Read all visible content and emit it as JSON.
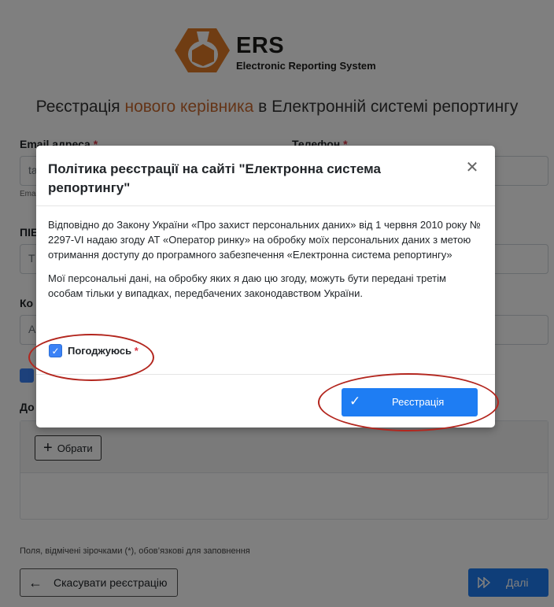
{
  "logo": {
    "title": "ERS",
    "subtitle": "Electronic Reporting System",
    "brand_color": "#e07b27"
  },
  "heading": {
    "prefix": "Реєстрація ",
    "accent": "нового керівника",
    "suffix": " в Електронній системі репортингу",
    "accent_color": "#c8692e"
  },
  "form": {
    "email_label": "Email адреса",
    "email_value": "ta",
    "email_hint": "Ema",
    "phone_label": "Телефон",
    "name_label_partial": "ПІЕ",
    "name_placeholder_partial": "Т",
    "company_label_partial": "Ко",
    "company_placeholder_partial": "А",
    "docs_label_partial": "До",
    "required_mark": "*"
  },
  "upload": {
    "choose_label": "Обрати"
  },
  "footer": {
    "footnote": "Поля, відмічені зірочками (*), обов’язкові для заповнення",
    "cancel_label": "Скасувати реєстрацію",
    "next_label": "Далі"
  },
  "modal": {
    "title": "Політика реєстрації на сайті \"Електронна система репортингу\"",
    "paragraph_1": "Відповідно до Закону України «Про захист персональних даних» від 1 червня 2010 року № 2297-VI надаю згоду АТ «Оператор ринку» на обробку моїх персональних даних з метою отримання доступу до програмного забезпечення «Електронна система репортингу»",
    "paragraph_2": "Мої персональні дані, на обробку яких я даю цю згоду, можуть бути передані третім особам тільки у випадках, передбачених законодавством України.",
    "agree_label": "Погоджуюсь",
    "agree_checked": true,
    "register_label": "Реєстрація"
  },
  "colors": {
    "primary": "#1e7df3",
    "required": "#dc3545",
    "annotation": "#b3261e"
  },
  "icons": [
    "close-icon",
    "check-icon",
    "plus-icon",
    "arrow-left-icon",
    "forward-icon"
  ]
}
